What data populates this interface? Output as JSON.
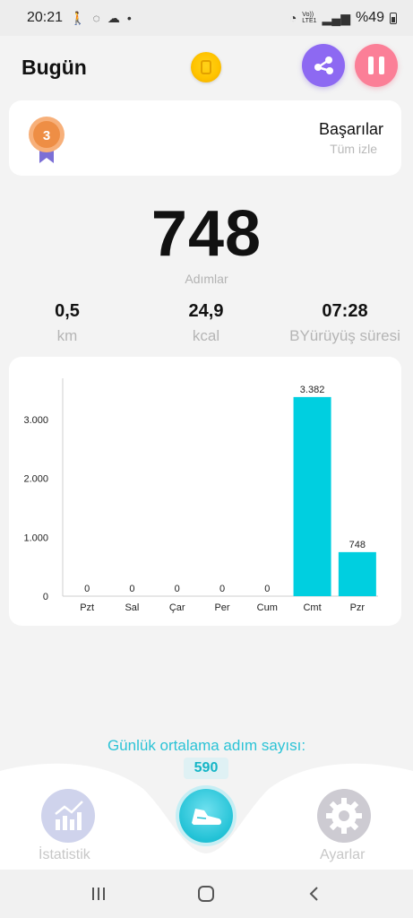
{
  "status_bar": {
    "time": "20:21",
    "network": "Vo))\nLTE1",
    "battery": "%49"
  },
  "header": {
    "title": "Bugün"
  },
  "achievements": {
    "title": "Başarılar",
    "link": "Tüm izle",
    "medal_text": "3"
  },
  "steps": {
    "value": "748",
    "label": "Adımlar"
  },
  "stats": [
    {
      "value": "0,5",
      "label": "km"
    },
    {
      "value": "24,9",
      "label": "kcal"
    },
    {
      "value": "07:28",
      "label": "BYürüyüş süresi"
    }
  ],
  "chart_data": {
    "type": "bar",
    "categories": [
      "Pzt",
      "Sal",
      "Çar",
      "Per",
      "Cum",
      "Cmt",
      "Pzr"
    ],
    "values": [
      0,
      0,
      0,
      0,
      0,
      3382,
      748
    ],
    "value_labels": [
      "0",
      "0",
      "0",
      "0",
      "0",
      "3.382",
      "748"
    ],
    "yticks": [
      0,
      1000,
      2000,
      3000
    ],
    "ytick_labels": [
      "0",
      "1.000",
      "2.000",
      "3.000"
    ],
    "ylim": [
      0,
      3700
    ],
    "bar_color": "#00cfe0",
    "grid": false
  },
  "daily_average": {
    "label": "Günlük ortalama adım sayısı:",
    "value": "590"
  },
  "bottom_nav": {
    "stats_label": "İstatistik",
    "settings_label": "Ayarlar"
  },
  "colors": {
    "accent": "#22c2d6",
    "share": "#8d69f2",
    "pause": "#fb7f97"
  }
}
